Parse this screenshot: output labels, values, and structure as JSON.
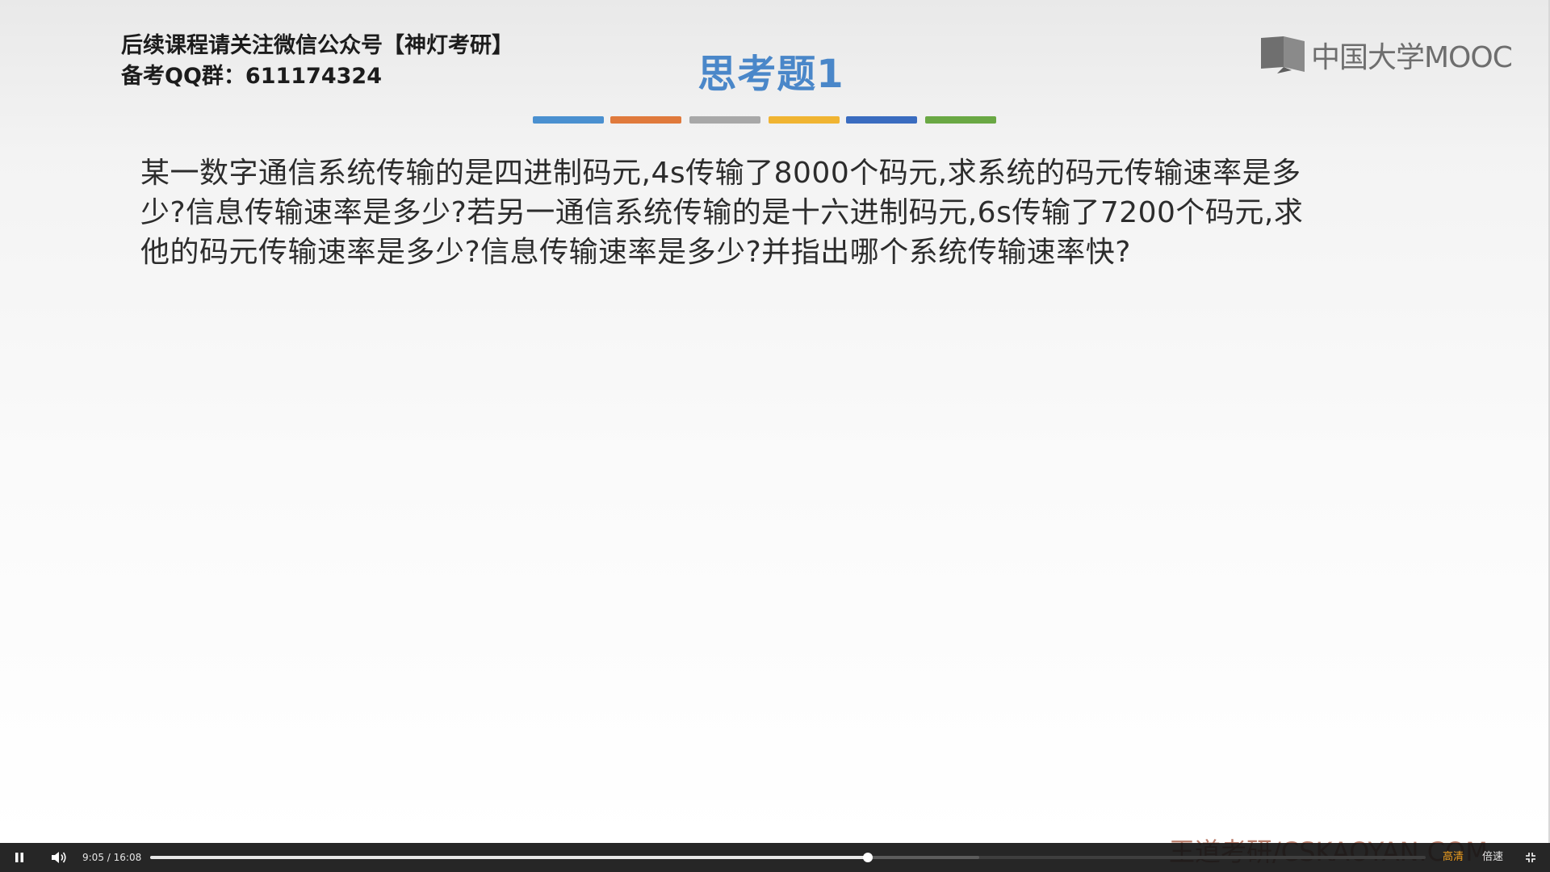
{
  "header": {
    "promo_line1": "后续课程请关注微信公众号【神灯考研】",
    "promo_line2": "备考QQ群：611174324",
    "slide_title": "思考题1",
    "logo_text": "中国大学MOOC"
  },
  "color_bars": [
    "#4a90d0",
    "#e07a3c",
    "#a8a8a8",
    "#f0b432",
    "#3a6cc0",
    "#6aa844"
  ],
  "question": {
    "line1": "某一数字通信系统传输的是四进制码元,4s传输了8000个码元,求系统的码元传输速率是多",
    "line2": "少?信息传输速率是多少?若另一通信系统传输的是十六进制码元,6s传输了7200个码元,求",
    "line3": "他的码元传输速率是多少?信息传输速率是多少?并指出哪个系统传输速率快?"
  },
  "watermark": "王道考研/CSKAOYAN.COM",
  "player": {
    "current_time": "9:05",
    "separator": "/",
    "duration": "16:08",
    "played_fraction": 0.5625,
    "buffered_fraction": 0.65,
    "quality_label": "高清",
    "speed_label": "倍速",
    "icons": [
      "pause-icon",
      "volume-icon",
      "exit-fullscreen-icon"
    ]
  }
}
